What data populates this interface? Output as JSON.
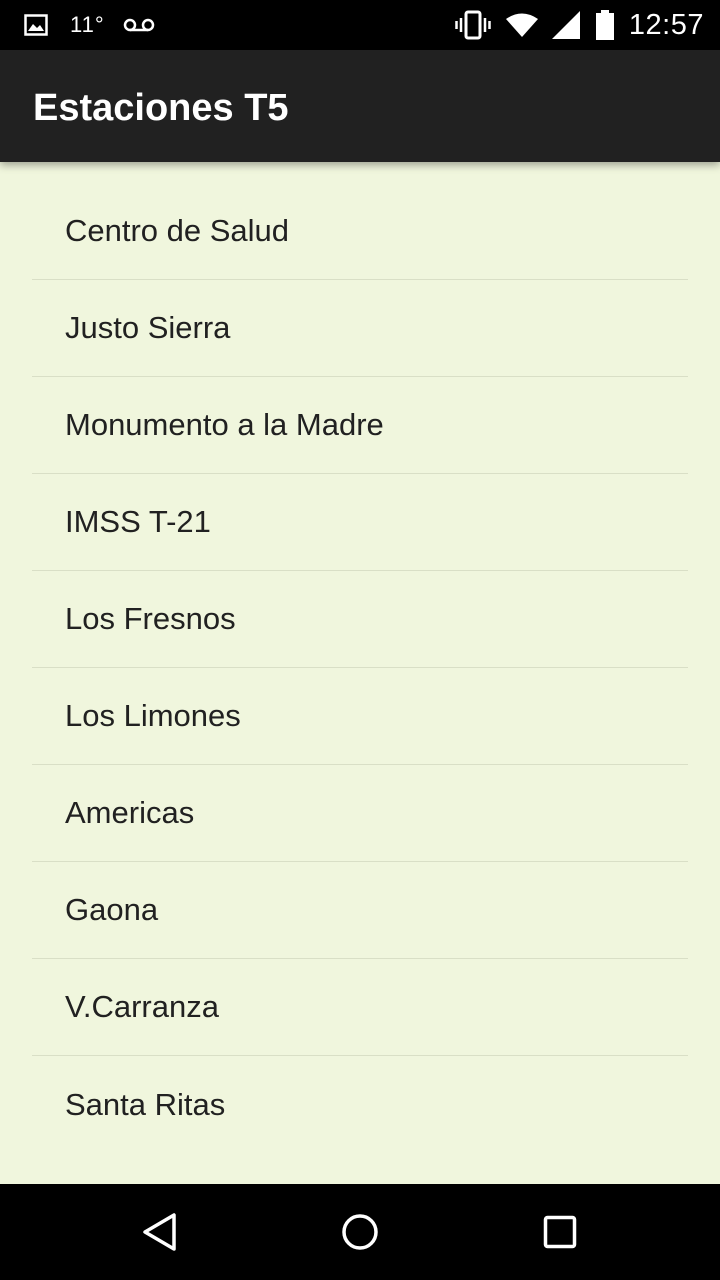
{
  "status_bar": {
    "temperature": "11°",
    "time": "12:57",
    "icons": [
      "image-icon",
      "voicemail-icon",
      "vibrate-icon",
      "wifi-icon",
      "signal-icon",
      "battery-icon"
    ]
  },
  "app_bar": {
    "title": "Estaciones T5"
  },
  "stations": [
    "Centro de Salud",
    "Justo Sierra",
    "Monumento a la Madre",
    "IMSS T-21",
    "Los Fresnos",
    "Los Limones",
    "Americas",
    "Gaona",
    "V.Carranza",
    "Santa Ritas"
  ],
  "navigation": {
    "icons": [
      "back-icon",
      "home-icon",
      "recents-icon"
    ]
  },
  "colors": {
    "status_bar": "#000000",
    "app_bar": "#212121",
    "list_background": "#f0f6dd",
    "divider": "#d9dfc6",
    "text": "#212121"
  }
}
